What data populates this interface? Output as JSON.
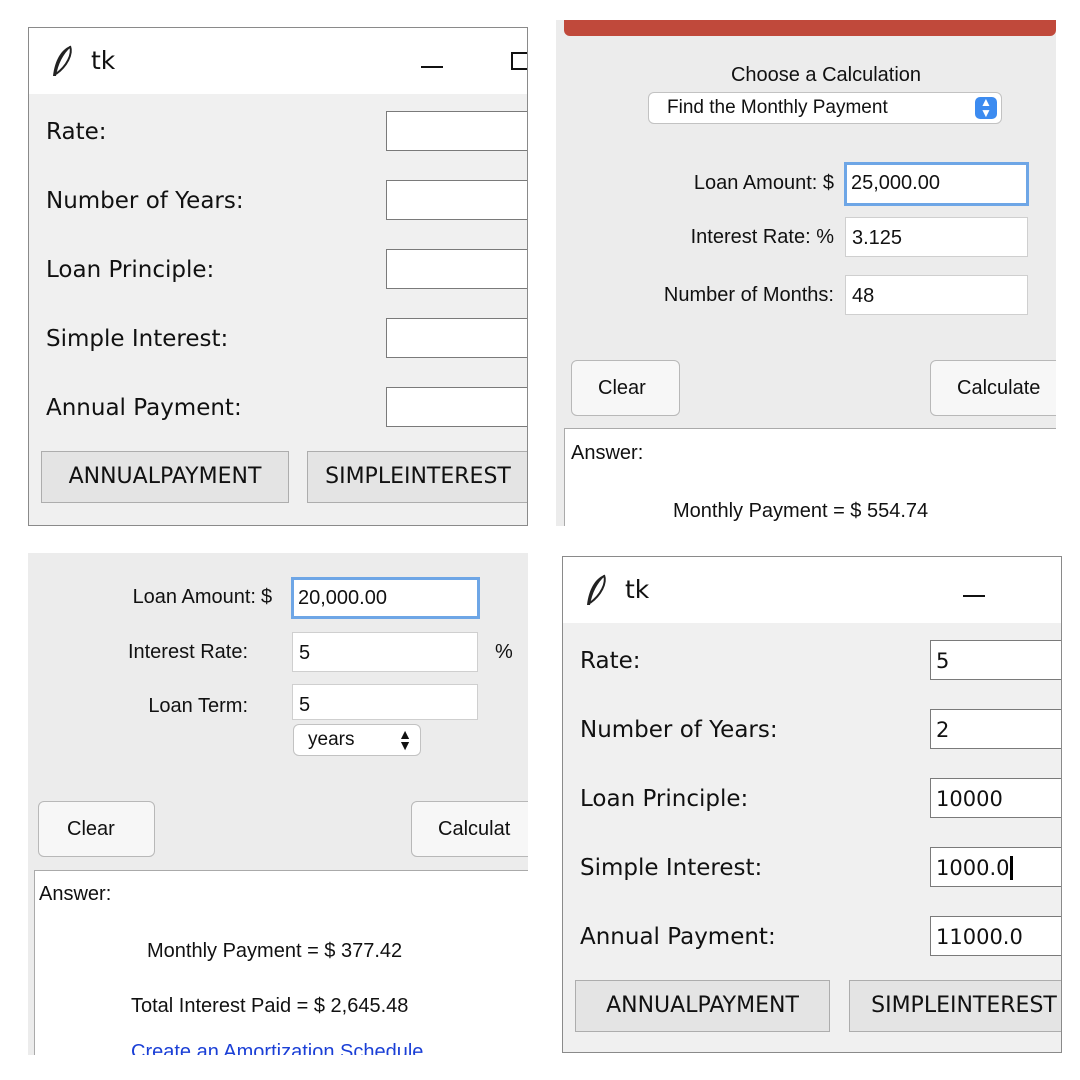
{
  "tk_empty": {
    "title": "tk",
    "labels": [
      "Rate:",
      "Number of Years:",
      "Loan Principle:",
      "Simple Interest:",
      "Annual Payment:"
    ],
    "values": [
      "",
      "",
      "",
      "",
      ""
    ],
    "buttons": [
      "ANNUALPAYMENT",
      "SIMPLEINTEREST"
    ]
  },
  "monthly_calc": {
    "heading": "Choose a Calculation",
    "dropdown": "Find the Monthly Payment",
    "loan_amount_label": "Loan Amount: $",
    "loan_amount": "25,000.00",
    "interest_rate_label": "Interest Rate: %",
    "interest_rate": "3.125",
    "months_label": "Number of Months:",
    "months": "48",
    "clear_label": "Clear",
    "calculate_label": "Calculate",
    "answer_label": "Answer:",
    "result": "Monthly Payment = $ 554.74",
    "accent_color": "#c0493b"
  },
  "loan_calc": {
    "loan_amount_label": "Loan Amount:",
    "currency": "$",
    "loan_amount": "20,000.00",
    "interest_rate_label": "Interest Rate:",
    "interest_rate": "5",
    "percent": "%",
    "loan_term_label": "Loan Term:",
    "loan_term": "5",
    "term_unit": "years",
    "clear_label": "Clear",
    "calculate_label": "Calculat",
    "answer_label": "Answer:",
    "monthly_payment": "Monthly Payment = $ 377.42",
    "total_interest": "Total Interest Paid = $ 2,645.48",
    "link": "Create an Amortization Schedule",
    "link_color": "#1a3fd6"
  },
  "tk_filled": {
    "title": "tk",
    "labels": [
      "Rate:",
      "Number of Years:",
      "Loan Principle:",
      "Simple Interest:",
      "Annual Payment:"
    ],
    "values": [
      "5",
      "2",
      "10000",
      "1000.0",
      "11000.0"
    ],
    "buttons": [
      "ANNUALPAYMENT",
      "SIMPLEINTEREST"
    ]
  }
}
